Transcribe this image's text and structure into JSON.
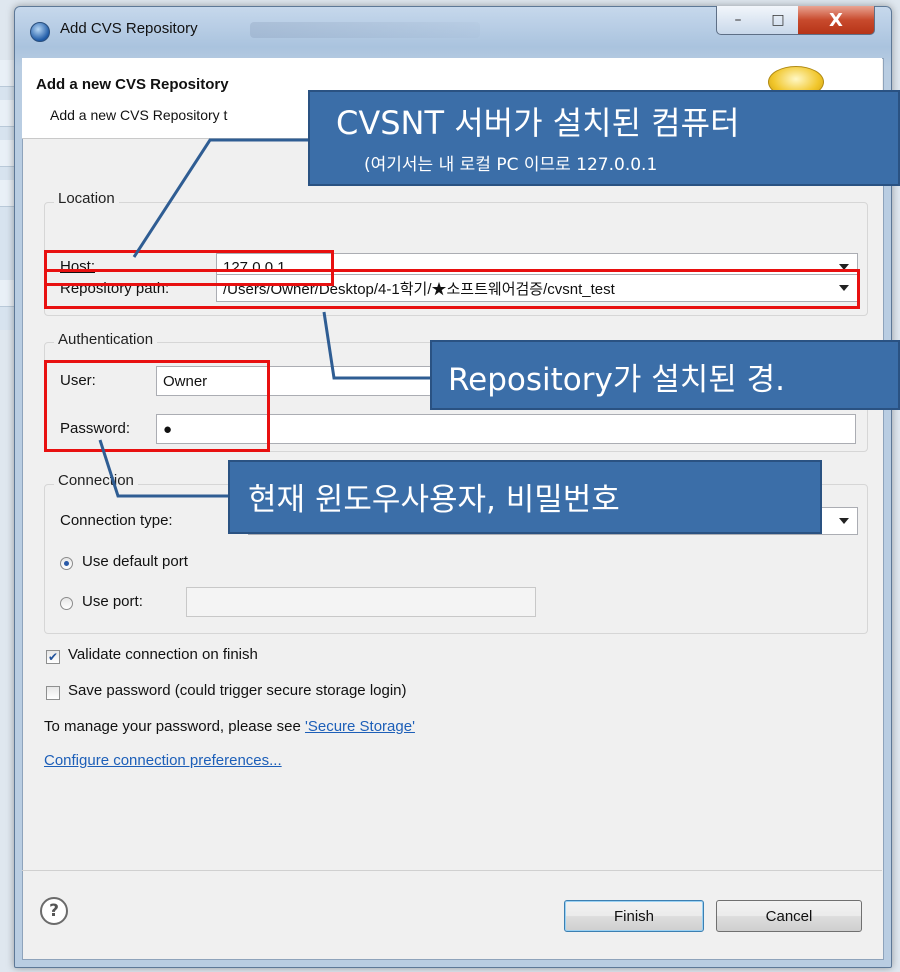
{
  "window": {
    "title": "Add CVS Repository",
    "controls": {
      "minimize": "–",
      "maximize": "□",
      "close": "X"
    }
  },
  "header": {
    "title": "Add a new CVS Repository",
    "description": "Add a new CVS Repository t"
  },
  "location": {
    "legend": "Location",
    "host_label": "Host:",
    "host_value": "127.0.0.1",
    "path_label": "Repository path:",
    "path_value": "/Users/Owner/Desktop/4-1학기/★소프트웨어검증/cvsnt_test"
  },
  "authentication": {
    "legend": "Authentication",
    "user_label": "User:",
    "user_value": "Owner",
    "password_label": "Password:",
    "password_value": "●"
  },
  "connection": {
    "legend": "Connection",
    "type_label": "Connection type:",
    "default_port_label": "Use default port",
    "use_port_label": "Use port:",
    "port_value": ""
  },
  "options": {
    "validate_label": "Validate connection on finish",
    "validate_checked": true,
    "save_password_label": "Save password (could trigger secure storage login)",
    "save_password_checked": false,
    "manage_text": "To manage your password, please see ",
    "secure_storage_link": "'Secure Storage'",
    "configure_link": "Configure connection preferences..."
  },
  "buttons": {
    "help": "?",
    "finish": "Finish",
    "cancel": "Cancel"
  },
  "annotations": {
    "callout1_line1": "CVSNT 서버가 설치된 컴퓨터",
    "callout1_line2": "(여기서는 내 로컬 PC 이므로 127.0.0.1",
    "callout2": "Repository가 설치된 경.",
    "callout3": "현재 윈도우사용자, 비밀번호"
  },
  "colors": {
    "annotation_red": "#e81010",
    "callout_blue": "#3b6ea8",
    "link_blue": "#1d5fb8"
  }
}
